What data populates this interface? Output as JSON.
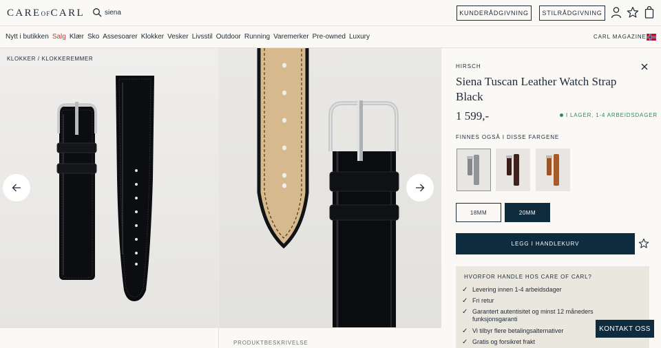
{
  "header": {
    "logo_left": "CARE",
    "logo_mid": "OF",
    "logo_right": "CARL",
    "search_value": "siena",
    "customer_service_label": "KUNDERÅDGIVNING",
    "style_advice_label": "STILRÅDGIVNING",
    "icons": [
      "search-icon",
      "user-icon",
      "star-icon",
      "bag-icon"
    ]
  },
  "nav": {
    "items": [
      "Nytt i butikken",
      "Salg",
      "Klær",
      "Sko",
      "Assesoarer",
      "Klokker",
      "Vesker",
      "Livsstil",
      "Outdoor",
      "Running",
      "Varemerker",
      "Pre-owned",
      "Luxury"
    ],
    "sale_color": "#c8323a",
    "magazine_label": "CARL MAGAZINE"
  },
  "gallery": {
    "breadcrumb": "KLOKKER / KLOKKEREMMER",
    "description_label": "PRODUKTBESKRIVELSE"
  },
  "product": {
    "brand": "HIRSCH",
    "title": "Siena Tuscan Leather Watch Strap Black",
    "price": "1 599,-",
    "stock": "I LAGER, 1-4 ARBEIDSDAGER",
    "stock_color": "#2f8a55",
    "colors_label": "FINNES OGSÅ I DISSE FARGENE",
    "color_swatches": [
      "grey",
      "dark brown",
      "tan"
    ],
    "sizes": [
      "18MM",
      "20MM"
    ],
    "selected_size": "20MM",
    "add_to_cart_label": "LEGG I HANDLEKURV",
    "accent_color": "#0f2b3e"
  },
  "why": {
    "title": "HVORFOR HANDLE HOS CARE OF CARL?",
    "items": [
      "Levering innen 1-4 arbeidsdager",
      "Fri retur",
      "Garantert autentisitet og minst 12 måneders funksjonsgaranti",
      "Vi tilbyr flere betalingsalternativer",
      "Gratis og forsikret frakt"
    ]
  },
  "contact_label": "KONTAKT OSS"
}
